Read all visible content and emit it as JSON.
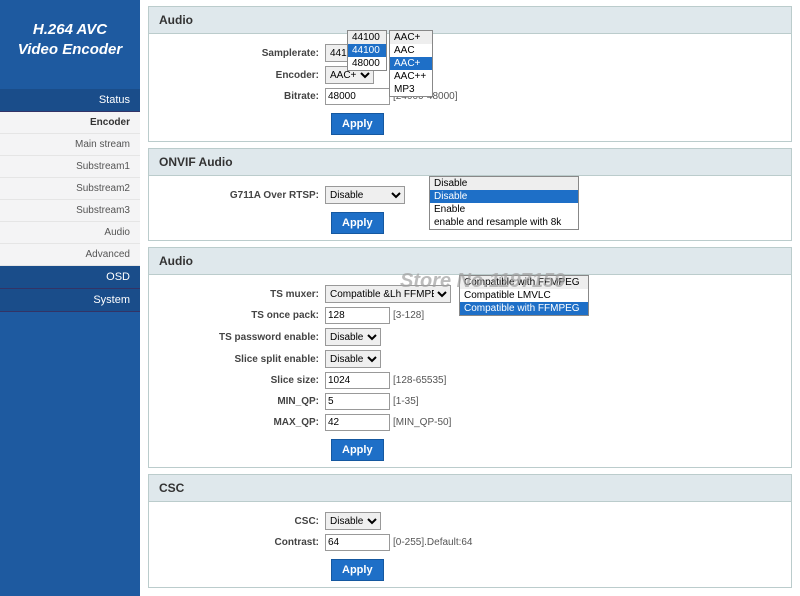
{
  "logo_line1": "H.264 AVC",
  "logo_line2": "Video Encoder",
  "nav": {
    "status": "Status",
    "encoder": "Encoder",
    "main_stream": "Main stream",
    "sub1": "Substream1",
    "sub2": "Substream2",
    "sub3": "Substream3",
    "audio": "Audio",
    "advanced": "Advanced",
    "osd": "OSD",
    "system": "System"
  },
  "audio": {
    "header": "Audio",
    "samplerate_label": "Samplerate:",
    "samplerate_value": "44100",
    "samplerate_options": [
      "44100",
      "44100",
      "48000"
    ],
    "encoder_label": "Encoder:",
    "encoder_value": "AAC+",
    "encoder_options": [
      "AAC+",
      "AAC",
      "AAC+",
      "AAC++",
      "MP3"
    ],
    "bitrate_label": "Bitrate:",
    "bitrate_value": "48000",
    "bitrate_hint": "[24000-48000]",
    "apply": "Apply"
  },
  "onvif": {
    "header": "ONVIF Audio",
    "label": "G711A Over RTSP:",
    "value": "Disable",
    "options": [
      "Disable",
      "Disable",
      "Enable",
      "enable and resample with 8k"
    ],
    "apply": "Apply"
  },
  "ts": {
    "header": "Audio",
    "muxer_label": "TS muxer:",
    "muxer_value": "Compatible &Lh FFMPEG",
    "muxer_options": [
      "Compatible with FFMPEG",
      "Compatible LMVLC",
      "Compatible with FFMPEG"
    ],
    "once_label": "TS once pack:",
    "once_value": "128",
    "once_hint": "[3-128]",
    "pwd_label": "TS password enable:",
    "pwd_value": "Disable",
    "slice_en_label": "Slice split enable:",
    "slice_en_value": "Disable",
    "slice_size_label": "Slice size:",
    "slice_size_value": "1024",
    "slice_size_hint": "[128-65535]",
    "minqp_label": "MIN_QP:",
    "minqp_value": "5",
    "minqp_hint": "[1-35]",
    "maxqp_label": "MAX_QP:",
    "maxqp_value": "42",
    "maxqp_hint": "[MIN_QP-50]",
    "apply": "Apply"
  },
  "csc": {
    "header": "CSC",
    "csc_label": "CSC:",
    "csc_value": "Disable",
    "contrast_label": "Contrast:",
    "contrast_value": "64",
    "contrast_hint": "[0-255].Default:64",
    "apply": "Apply"
  },
  "watermark": "Store No.1197159"
}
